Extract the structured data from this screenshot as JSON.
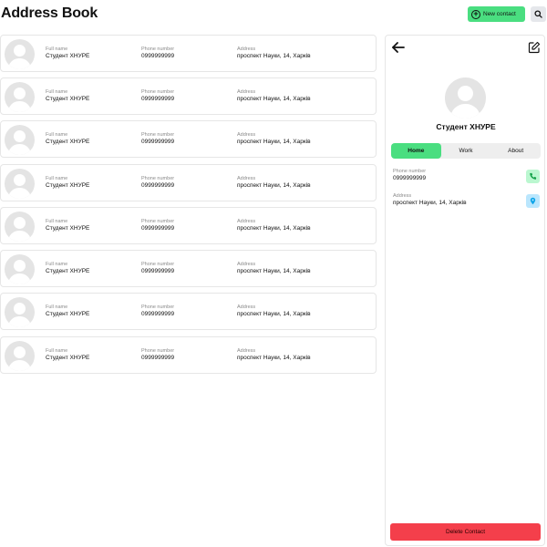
{
  "header": {
    "title": "Address Book",
    "new_contact_label": "New contact",
    "icons": {
      "new_contact": "plus-circle-icon",
      "search": "search-icon"
    }
  },
  "contacts": [
    {
      "name_label": "Full name",
      "name": "Студент ХНУРЕ",
      "phone_label": "Phone number",
      "phone": "0999999999",
      "address_label": "Address",
      "address": "проспект Науки, 14, Харків"
    },
    {
      "name_label": "Full name",
      "name": "Студент ХНУРЕ",
      "phone_label": "Phone number",
      "phone": "0999999999",
      "address_label": "Address",
      "address": "проспект Науки, 14, Харків"
    },
    {
      "name_label": "Full name",
      "name": "Студент ХНУРЕ",
      "phone_label": "Phone number",
      "phone": "0999999999",
      "address_label": "Address",
      "address": "проспект Науки, 14, Харків"
    },
    {
      "name_label": "Full name",
      "name": "Студент ХНУРЕ",
      "phone_label": "Phone number",
      "phone": "0999999999",
      "address_label": "Address",
      "address": "проспект Науки, 14, Харків"
    },
    {
      "name_label": "Full name",
      "name": "Студент ХНУРЕ",
      "phone_label": "Phone number",
      "phone": "0999999999",
      "address_label": "Address",
      "address": "проспект Науки, 14, Харків"
    },
    {
      "name_label": "Full name",
      "name": "Студент ХНУРЕ",
      "phone_label": "Phone number",
      "phone": "0999999999",
      "address_label": "Address",
      "address": "проспект Науки, 14, Харків"
    },
    {
      "name_label": "Full name",
      "name": "Студент ХНУРЕ",
      "phone_label": "Phone number",
      "phone": "0999999999",
      "address_label": "Address",
      "address": "проспект Науки, 14, Харків"
    },
    {
      "name_label": "Full name",
      "name": "Студент ХНУРЕ",
      "phone_label": "Phone number",
      "phone": "0999999999",
      "address_label": "Address",
      "address": "проспект Науки, 14, Харків"
    }
  ],
  "detail": {
    "name": "Студент ХНУРЕ",
    "tabs": [
      "Home",
      "Work",
      "About"
    ],
    "active_tab": "Home",
    "phone_label": "Phone number",
    "phone": "0999999999",
    "address_label": "Address",
    "address": "проспект Науки, 14, Харків",
    "delete_label": "Delete Contact",
    "icons": {
      "back": "arrow-left-icon",
      "edit": "edit-icon",
      "phone": "phone-icon",
      "location": "map-pin-icon"
    }
  },
  "colors": {
    "accent": "#4ade80",
    "danger": "#f43f4b",
    "phone_bg": "#bbf7d0",
    "location_bg": "#bae6fd"
  }
}
